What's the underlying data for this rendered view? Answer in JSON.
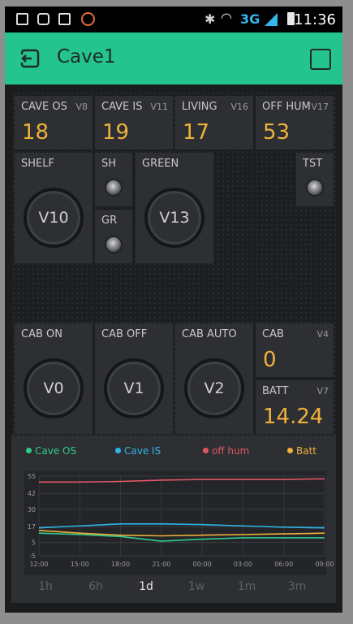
{
  "status_bar": {
    "time": "11:36",
    "network": "3G"
  },
  "app_bar": {
    "title": "Cave1",
    "accent": "#23c48e"
  },
  "value_tiles": [
    {
      "label": "CAVE OS",
      "pin": "V8",
      "value": "18"
    },
    {
      "label": "CAVE IS",
      "pin": "V11",
      "value": "19"
    },
    {
      "label": "LIVING",
      "pin": "V16",
      "value": "17"
    },
    {
      "label": "OFF HUM",
      "pin": "V17",
      "value": "53"
    }
  ],
  "widgets": {
    "shelf": {
      "label": "SHELF",
      "knob": "V10"
    },
    "sh": {
      "label": "SH"
    },
    "gr": {
      "label": "GR"
    },
    "green": {
      "label": "GREEN",
      "knob": "V13"
    },
    "tst": {
      "label": "TST"
    },
    "cab_on": {
      "label": "CAB ON",
      "knob": "V0"
    },
    "cab_off": {
      "label": "CAB OFF",
      "knob": "V1"
    },
    "cab_auto": {
      "label": "CAB AUTO",
      "knob": "V2"
    },
    "cab": {
      "label": "CAB",
      "pin": "V4",
      "value": "0"
    },
    "batt": {
      "label": "BATT",
      "pin": "V7",
      "value": "14.24"
    }
  },
  "value_color": "#f0b13c",
  "chart_data": {
    "type": "line",
    "x": [
      "12:00",
      "15:00",
      "18:00",
      "21:00",
      "00:00",
      "03:00",
      "06:00",
      "09:00"
    ],
    "yticks": [
      "55",
      "42",
      "30",
      "17",
      "5",
      "-5"
    ],
    "ylim": [
      -5,
      55
    ],
    "grid": true,
    "series": [
      {
        "name": "Cave OS",
        "color": "#2ecc8f",
        "values": [
          12,
          11,
          9.5,
          6,
          7.5,
          8.5,
          8.5,
          8.5
        ]
      },
      {
        "name": "Cave IS",
        "color": "#2db6e8",
        "values": [
          16,
          17.5,
          19,
          19,
          18.5,
          17.5,
          16.5,
          16
        ]
      },
      {
        "name": "off hum",
        "color": "#e05766",
        "values": [
          50.5,
          50.5,
          51,
          52,
          52.5,
          52.5,
          52.5,
          53
        ]
      },
      {
        "name": "Batt",
        "color": "#f0b13c",
        "values": [
          14,
          12,
          10.5,
          10,
          10.5,
          11,
          11.5,
          12
        ]
      }
    ]
  },
  "periods": [
    "1h",
    "6h",
    "1d",
    "1w",
    "1m",
    "3m"
  ],
  "active_period": "1d"
}
